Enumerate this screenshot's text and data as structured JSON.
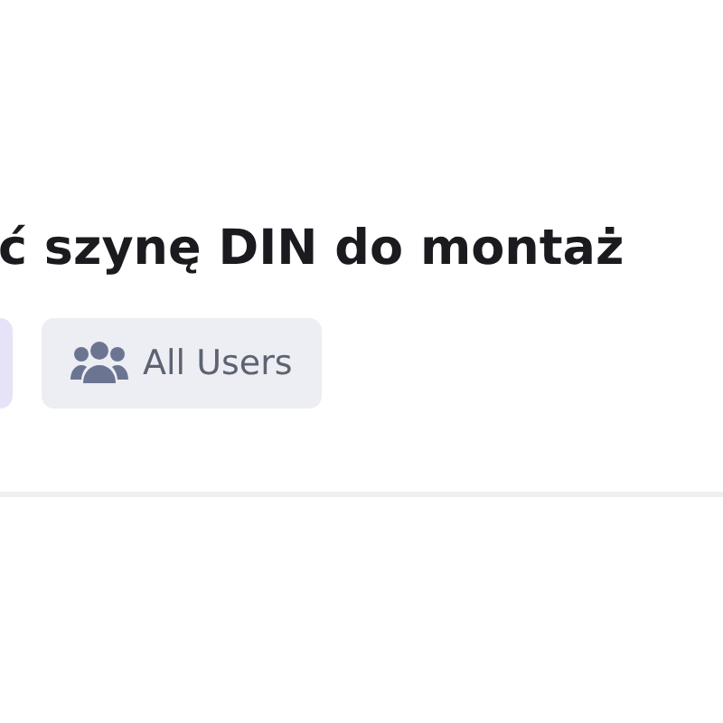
{
  "title": "ć szynę DIN do montaż",
  "tags": [
    {
      "kind": "cut"
    },
    {
      "kind": "audience",
      "label": "All Users"
    }
  ]
}
